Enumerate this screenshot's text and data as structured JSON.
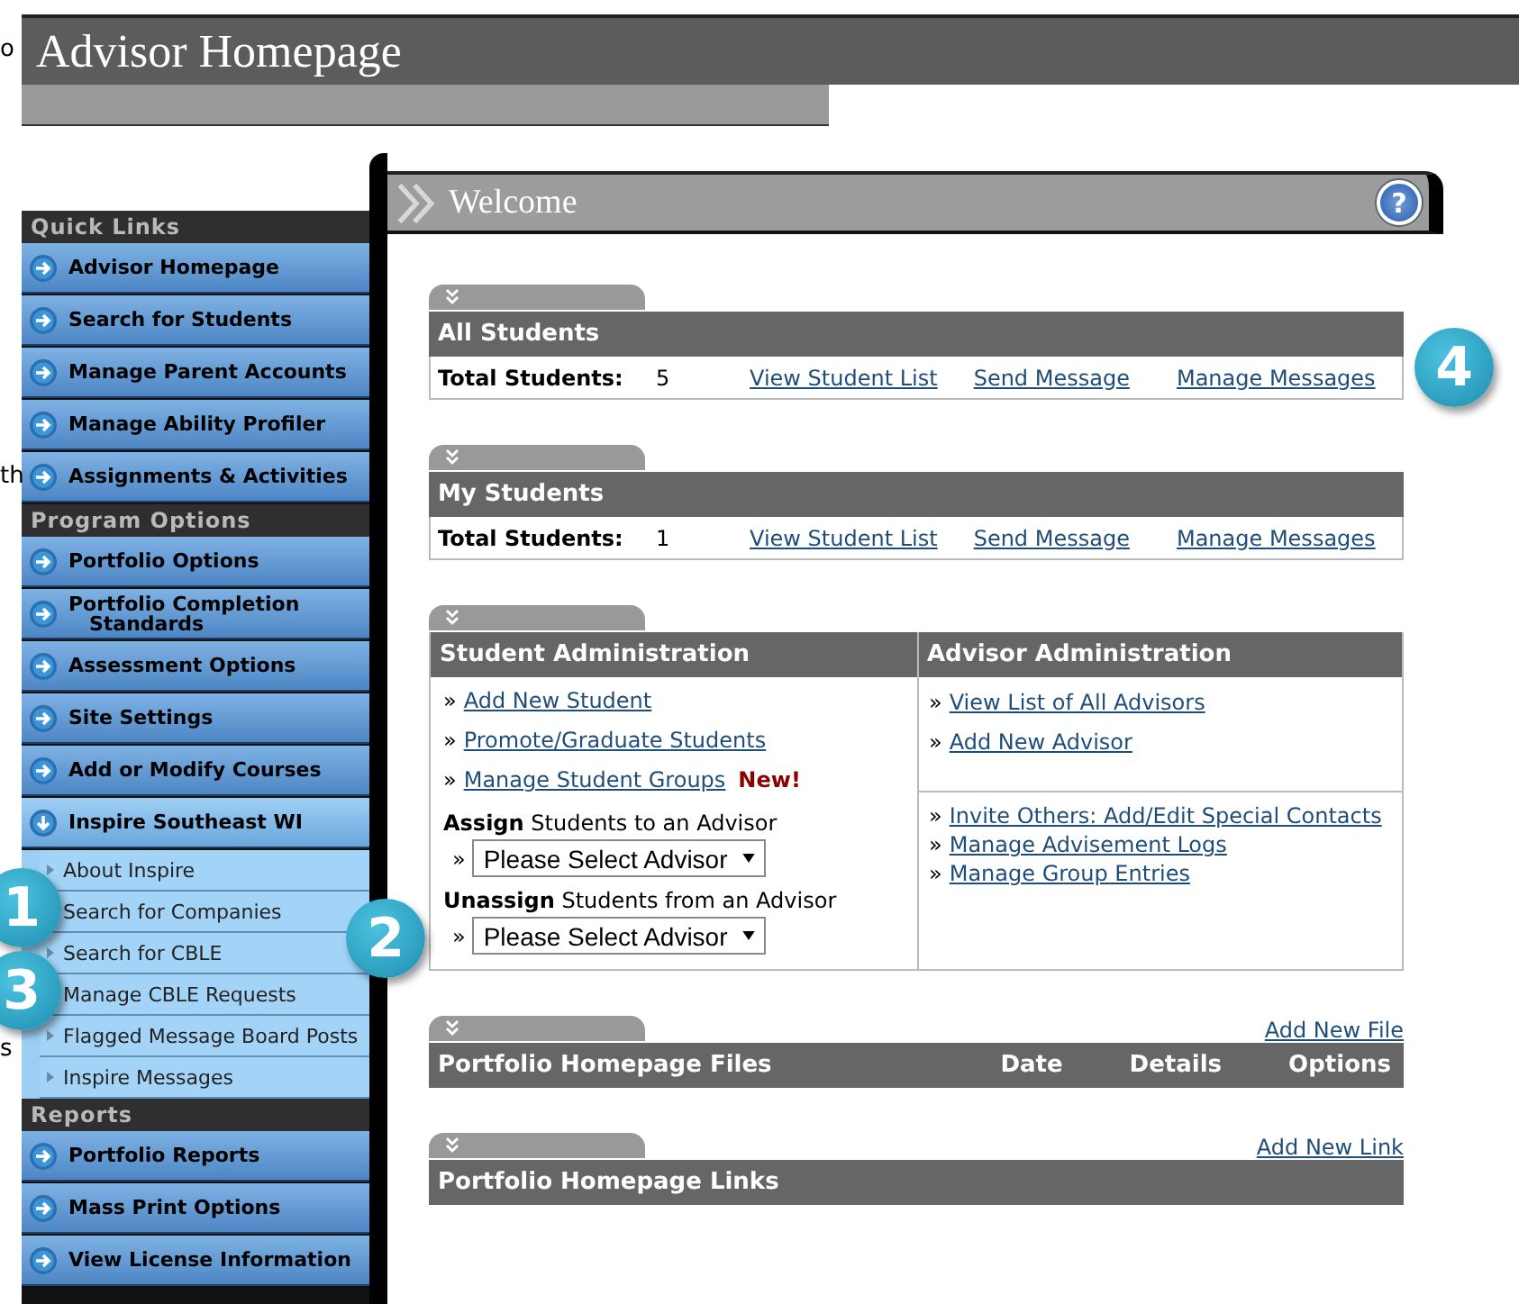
{
  "window": {
    "title": "Advisor Homepage"
  },
  "background_fragments": [
    "o",
    "th",
    "s"
  ],
  "sidebar": {
    "sections": [
      {
        "title": "Quick Links",
        "items": [
          {
            "label": "Advisor Homepage",
            "expanded": false
          },
          {
            "label": "Search for Students",
            "expanded": false
          },
          {
            "label": "Manage Parent Accounts",
            "expanded": false
          },
          {
            "label": "Manage Ability Profiler",
            "expanded": false
          },
          {
            "label": "Assignments & Activities",
            "expanded": false
          }
        ]
      },
      {
        "title": "Program Options",
        "items": [
          {
            "label": "Portfolio Options",
            "expanded": false
          },
          {
            "label": "Portfolio Completion\n   Standards",
            "expanded": false
          },
          {
            "label": "Assessment Options",
            "expanded": false
          },
          {
            "label": "Site Settings",
            "expanded": false
          },
          {
            "label": "Add or Modify Courses",
            "expanded": false
          },
          {
            "label": "Inspire Southeast WI",
            "expanded": true,
            "children": [
              {
                "label": "About Inspire",
                "marker": true
              },
              {
                "label": "Search for Companies",
                "marker": false
              },
              {
                "label": "Search for CBLE",
                "marker": true
              },
              {
                "label": "Manage CBLE Requests",
                "marker": false
              },
              {
                "label": "Flagged Message Board Posts",
                "marker": true
              },
              {
                "label": "Inspire Messages",
                "marker": true
              }
            ]
          }
        ]
      },
      {
        "title": "Reports",
        "items": [
          {
            "label": "Portfolio Reports",
            "expanded": false
          },
          {
            "label": "Mass Print Options",
            "expanded": false
          },
          {
            "label": "View License Information",
            "expanded": false
          }
        ]
      }
    ]
  },
  "welcome": {
    "title": "Welcome",
    "help": "?"
  },
  "panels": [
    {
      "kind": "stats",
      "title": "All Students",
      "total_label": "Total Students:",
      "total_value": "5",
      "links": [
        "View Student List",
        "Send Message",
        "Manage Messages"
      ]
    },
    {
      "kind": "stats",
      "title": "My Students",
      "total_label": "Total Students:",
      "total_value": "1",
      "links": [
        "View Student List",
        "Send Message",
        "Manage Messages"
      ]
    },
    {
      "kind": "admin",
      "left": {
        "title": "Student Administration",
        "links": [
          {
            "label": "Add New Student"
          },
          {
            "label": "Promote/Graduate Students"
          },
          {
            "label": "Manage Student Groups",
            "badge": "New!"
          }
        ],
        "assign": [
          {
            "text": "**Assign** Students to an Advisor",
            "select": "Please Select Advisor"
          },
          {
            "text": "**Unassign** Students from an Advisor",
            "select": "Please Select Advisor"
          }
        ]
      },
      "right": {
        "title": "Advisor Administration",
        "groups": [
          [
            "View List of All Advisors",
            "Add New Advisor"
          ],
          [
            "Invite Others: Add/Edit Special Contacts",
            "Manage Advisement Logs",
            "Manage Group Entries"
          ]
        ]
      }
    },
    {
      "kind": "files",
      "action": "Add New File",
      "title": "Portfolio Homepage Files",
      "columns": [
        "Date",
        "Details",
        "Options"
      ]
    },
    {
      "kind": "links",
      "action": "Add New Link",
      "title": "Portfolio Homepage Links"
    }
  ],
  "callouts": [
    "1",
    "2",
    "3",
    "4"
  ],
  "bullet": "»"
}
